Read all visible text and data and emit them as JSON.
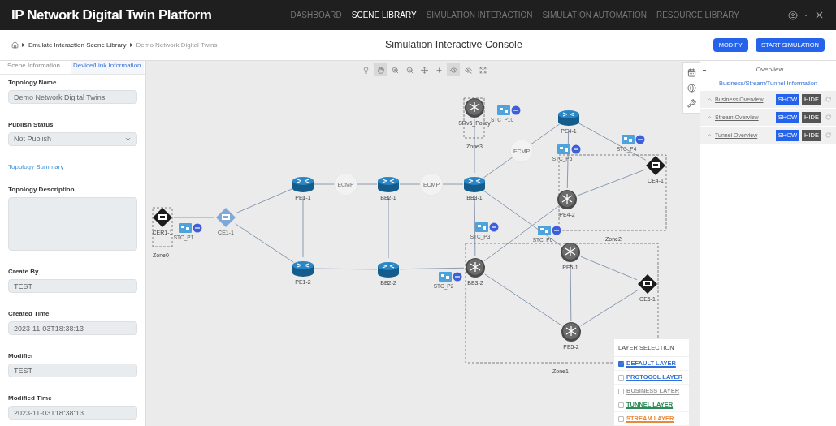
{
  "header": {
    "title": "IP Network Digital Twin Platform",
    "nav": [
      {
        "label": "DASHBOARD",
        "selected": false
      },
      {
        "label": "SCENE LIBRARY",
        "selected": true
      },
      {
        "label": "SIMULATION INTERACTION",
        "selected": false
      },
      {
        "label": "SIMULATION AUTOMATION",
        "selected": false
      },
      {
        "label": "RESOURCE LIBRARY",
        "selected": false
      }
    ]
  },
  "subbar": {
    "breadcrumb": [
      {
        "label": "Emulate Interaction Scene Library",
        "current": false
      },
      {
        "label": "Demo Network Digital Twins",
        "current": true
      }
    ],
    "title": "Simulation Interactive Console",
    "buttons": [
      "MODIFY",
      "START SIMULATION"
    ]
  },
  "left_panel": {
    "tabs": [
      {
        "label": "Scene Information",
        "selected": false
      },
      {
        "label": "Device/Link Information",
        "selected": true
      }
    ],
    "fields": [
      {
        "kind": "text",
        "label": "Topology Name",
        "value": "Demo Network Digital Twins"
      },
      {
        "kind": "select",
        "label": "Publish Status",
        "value": "Not Publish"
      },
      {
        "kind": "link",
        "label": "Topology Summary"
      },
      {
        "kind": "textarea",
        "label": "Topology Description"
      },
      {
        "kind": "text",
        "label": "Create By",
        "value": "TEST"
      },
      {
        "kind": "text",
        "label": "Created Time",
        "value": "2023-11-03T18:38:13"
      },
      {
        "kind": "text",
        "label": "Modifier",
        "value": "TEST"
      },
      {
        "kind": "text",
        "label": "Modified Time",
        "value": "2023-11-03T18:38:13"
      }
    ]
  },
  "canvas": {
    "toolbar": [
      {
        "kind": "bulb",
        "selected": false
      },
      {
        "kind": "hand",
        "selected": true
      },
      {
        "kind": "zoom-in",
        "selected": false
      },
      {
        "kind": "zoom-out",
        "selected": false
      },
      {
        "kind": "move",
        "selected": false
      },
      {
        "kind": "plus",
        "selected": false
      },
      {
        "kind": "eye",
        "selected": true
      },
      {
        "kind": "eye-outline",
        "selected": false
      },
      {
        "kind": "expand",
        "selected": false
      }
    ],
    "zones": [
      {
        "label": "Zone3"
      },
      {
        "label": "Zone2"
      },
      {
        "label": "Zone0"
      },
      {
        "label": "Zone1"
      }
    ],
    "nodes": [
      {
        "label": "SRv6_Policy",
        "kind": "core"
      },
      {
        "label": "PE4-1",
        "kind": "router"
      },
      {
        "label": "CE4-1",
        "kind": "ce"
      },
      {
        "label": "PE1-1",
        "kind": "router"
      },
      {
        "label": "BB2-1",
        "kind": "router"
      },
      {
        "label": "BB3-1",
        "kind": "router"
      },
      {
        "label": "PE4-2",
        "kind": "core"
      },
      {
        "label": "CER1-1",
        "kind": "ce"
      },
      {
        "label": "CE1-1",
        "kind": "ce-light"
      },
      {
        "label": "PE5-1",
        "kind": "core"
      },
      {
        "label": "PE1-2",
        "kind": "router"
      },
      {
        "label": "BB2-2",
        "kind": "router"
      },
      {
        "label": "BB3-2",
        "kind": "core"
      },
      {
        "label": "CE5-1",
        "kind": "ce"
      },
      {
        "label": "PE5-2",
        "kind": "core"
      }
    ],
    "link_labels": [
      "ECMP",
      "ECMP",
      "ECMP"
    ],
    "ports": [
      {
        "label": "STC_P10"
      },
      {
        "label": "STC_P4"
      },
      {
        "label": "STC_P5"
      },
      {
        "label": "STC_P1"
      },
      {
        "label": "STC_P3"
      },
      {
        "label": "STC_P6"
      },
      {
        "label": "STC_P2"
      }
    ],
    "layer_selection": {
      "title": "LAYER SELECTION",
      "items": [
        {
          "label": "DEFAULT LAYER",
          "checked": true,
          "color": "#2f6fd6"
        },
        {
          "label": "PROTOCOL LAYER",
          "checked": false,
          "color": "#2f6fd6"
        },
        {
          "label": "BUSINESS LAYER",
          "checked": false,
          "color": "#9a9a9a"
        },
        {
          "label": "TUNNEL LAYER",
          "checked": false,
          "color": "#2e8b57"
        },
        {
          "label": "STREAM LAYER",
          "checked": false,
          "color": "#e8893a"
        }
      ]
    }
  },
  "right_panel": {
    "title": "Overview",
    "subtitle": "Business/Stream/Tunnel Information",
    "rows": [
      {
        "label": "Business Overview",
        "show": "SHOW",
        "hide": "HIDE"
      },
      {
        "label": "Stream Overview",
        "show": "SHOW",
        "hide": "HIDE"
      },
      {
        "label": "Tunnel Overview",
        "show": "SHOW",
        "hide": "HIDE"
      }
    ]
  }
}
